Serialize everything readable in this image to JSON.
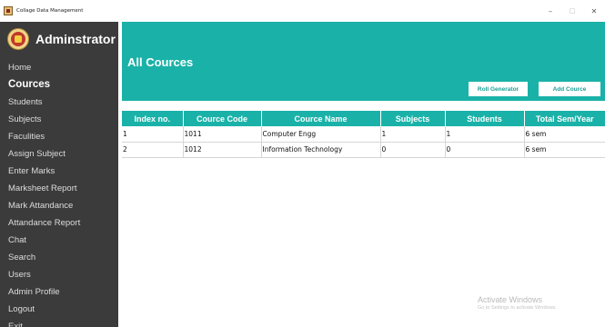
{
  "window": {
    "title": "Collage Data Management",
    "controls": {
      "minimize": "–",
      "maximize": "□",
      "close": "✕"
    }
  },
  "sidebar": {
    "user_name": "Adminstrator",
    "items": [
      {
        "label": "Home"
      },
      {
        "label": "Cources",
        "active": true
      },
      {
        "label": "Students"
      },
      {
        "label": "Subjects"
      },
      {
        "label": "Faculities"
      },
      {
        "label": "Assign Subject"
      },
      {
        "label": "Enter Marks"
      },
      {
        "label": "Marksheet Report"
      },
      {
        "label": "Mark Attandance"
      },
      {
        "label": "Attandance Report"
      },
      {
        "label": "Chat"
      },
      {
        "label": "Search"
      },
      {
        "label": "Users"
      },
      {
        "label": "Admin Profile"
      },
      {
        "label": "Logout"
      },
      {
        "label": "Exit"
      }
    ]
  },
  "main": {
    "page_title": "All Cources",
    "buttons": {
      "roll_generator": "Roll Generator",
      "add_cource": "Add Cource"
    },
    "table": {
      "columns": [
        "Index no.",
        "Cource Code",
        "Cource Name",
        "Subjects",
        "Students",
        "Total Sem/Year"
      ],
      "rows": [
        [
          "1",
          "1011",
          "Computer Engg",
          "1",
          "1",
          "6 sem"
        ],
        [
          "2",
          "1012",
          "Information Technology",
          "0",
          "0",
          "6 sem"
        ]
      ]
    }
  },
  "watermark": {
    "line1": "Activate Windows",
    "line2": "Go to Settings to activate Windows."
  },
  "colors": {
    "accent": "#1ab2a8",
    "sidebar_bg": "#3b3b3b"
  }
}
